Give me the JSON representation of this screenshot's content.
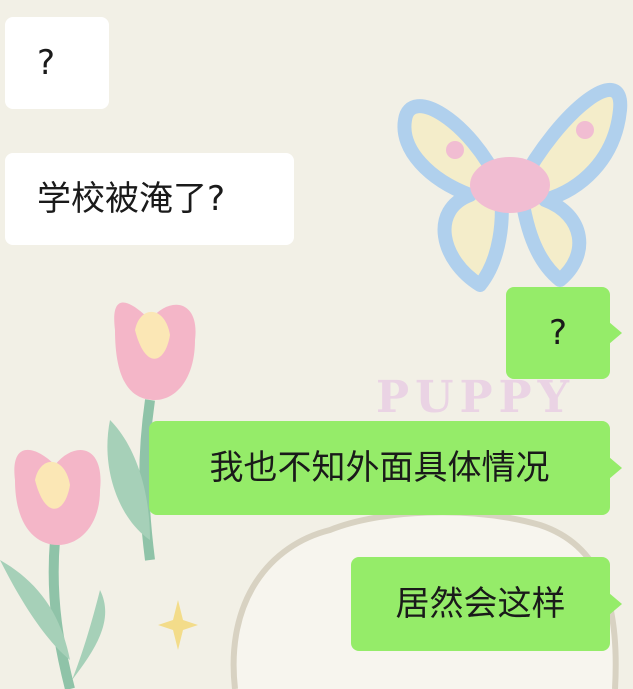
{
  "background": {
    "watermark_text": "PUPPY",
    "colors": {
      "canvas": "#f2f0e6",
      "butterfly": "#a9cdee",
      "tulip": "#f4b6c8",
      "leaf": "#8fc3a8"
    }
  },
  "messages": [
    {
      "direction": "incoming",
      "text": "?"
    },
    {
      "direction": "incoming",
      "text": "学校被淹了?"
    },
    {
      "direction": "outgoing",
      "text": "?"
    },
    {
      "direction": "outgoing",
      "text": "我也不知外面具体情况"
    },
    {
      "direction": "outgoing",
      "text": "居然会这样"
    }
  ],
  "colors": {
    "incoming_bubble": "#ffffff",
    "outgoing_bubble": "#95ec69",
    "text": "#1a1a1a"
  }
}
